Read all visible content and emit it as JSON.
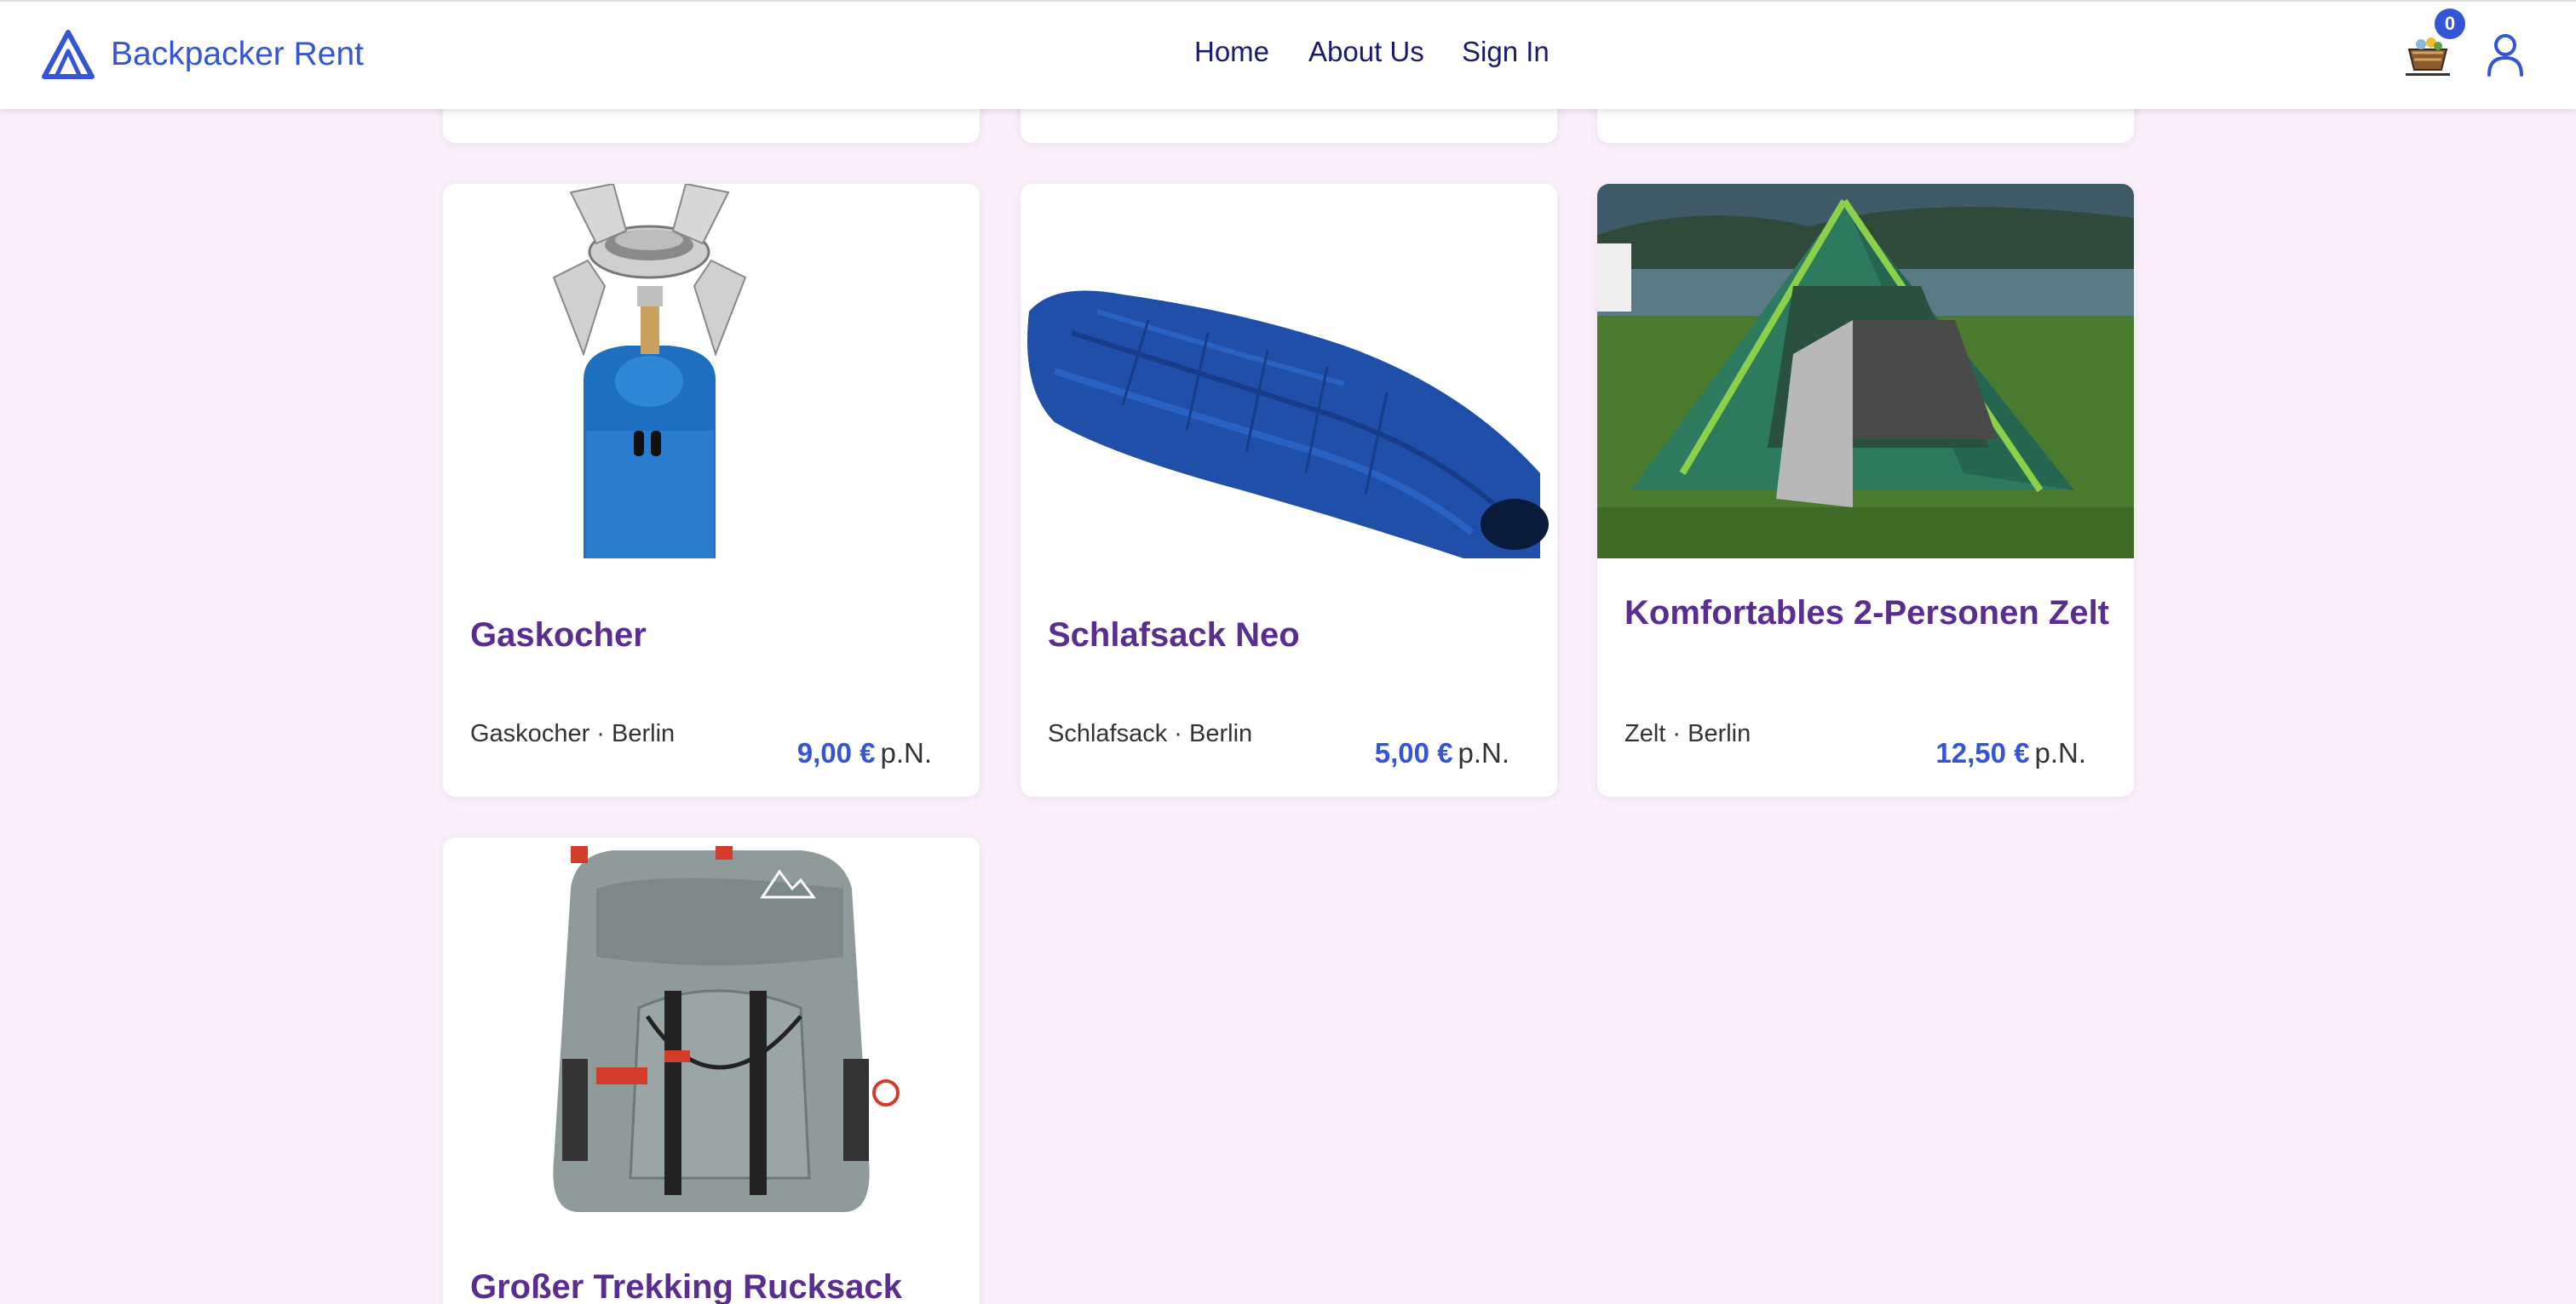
{
  "brand": {
    "name": "Backpacker Rent",
    "logo_icon": "triangle-logo-icon",
    "color": "#3456d6"
  },
  "nav": {
    "home": "Home",
    "about": "About Us",
    "signin": "Sign In"
  },
  "cart": {
    "count": "0",
    "icon": "cart-icon"
  },
  "user": {
    "icon": "user-icon"
  },
  "products": [
    {
      "title": "Gaskocher",
      "meta": "Gaskocher · Berlin",
      "price": "9,00 €",
      "unit": "p.N.",
      "image": "gas-stove"
    },
    {
      "title": "Schlafsack Neo",
      "meta": "Schlafsack · Berlin",
      "price": "5,00 €",
      "unit": "p.N.",
      "image": "sleeping-bag"
    },
    {
      "title": "Komfortables 2-Personen Zelt",
      "meta": "Zelt · Berlin",
      "price": "12,50 €",
      "unit": "p.N.",
      "image": "tent"
    },
    {
      "title": "Großer Trekking Rucksack",
      "image": "backpack"
    }
  ],
  "colors": {
    "background": "#fcf0fc",
    "title": "#5a2d91",
    "accent": "#3456d6"
  }
}
